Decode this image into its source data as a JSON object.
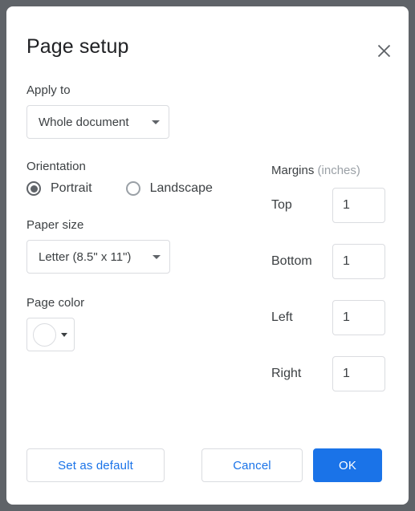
{
  "dialog": {
    "title": "Page setup",
    "close_icon": "close-icon"
  },
  "apply_to": {
    "label": "Apply to",
    "value": "Whole document",
    "caret_icon": "chevron-down-icon"
  },
  "orientation": {
    "label": "Orientation",
    "options": [
      {
        "label": "Portrait",
        "selected": true
      },
      {
        "label": "Landscape",
        "selected": false
      }
    ]
  },
  "paper_size": {
    "label": "Paper size",
    "value": "Letter (8.5\" x 11\")",
    "caret_icon": "chevron-down-icon"
  },
  "page_color": {
    "label": "Page color",
    "swatch_color": "#ffffff",
    "swatch_icon": "color-swatch-icon",
    "caret_icon": "chevron-down-icon"
  },
  "margins": {
    "title": "Margins",
    "unit": "(inches)",
    "fields": [
      {
        "label": "Top",
        "value": "1"
      },
      {
        "label": "Bottom",
        "value": "1"
      },
      {
        "label": "Left",
        "value": "1"
      },
      {
        "label": "Right",
        "value": "1"
      }
    ]
  },
  "footer": {
    "set_default_label": "Set as default",
    "cancel_label": "Cancel",
    "ok_label": "OK"
  },
  "colors": {
    "accent": "#1a73e8",
    "backdrop": "#5f6368",
    "border": "#dadce0",
    "text": "#3c4043"
  }
}
